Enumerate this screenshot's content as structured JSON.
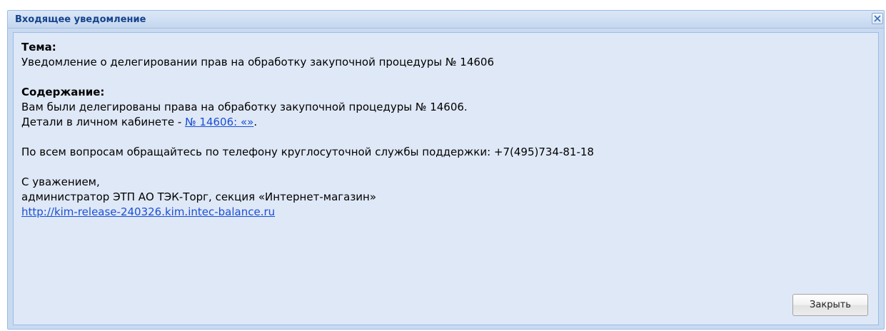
{
  "window": {
    "title": "Входящее уведомление"
  },
  "message": {
    "subject_heading": "Тема:",
    "subject_text": "Уведомление о делегировании прав на обработку закупочной процедуры № 14606",
    "content_heading": "Содержание:",
    "content_line1": "Вам были делегированы права на обработку закупочной процедуры № 14606.",
    "details_prefix": "Детали в личном кабинете - ",
    "details_link": "№ 14606: «»",
    "details_suffix": ".",
    "support_line": "По всем вопросам обращайтесь по телефону круглосуточной службы поддержки: +7(495)734-81-18",
    "regards": "С уважением,",
    "signature": "администратор ЭТП АО ТЭК-Торг, секция «Интернет-магазин»",
    "site_link": "http://kim-release-240326.kim.intec-balance.ru"
  },
  "buttons": {
    "close_label": "Закрыть"
  },
  "icons": {
    "close": "close-icon"
  },
  "colors": {
    "title_text": "#15428b",
    "link": "#1a4fd6",
    "panel_background": "#dfe8f6",
    "window_border": "#99bbe8"
  }
}
